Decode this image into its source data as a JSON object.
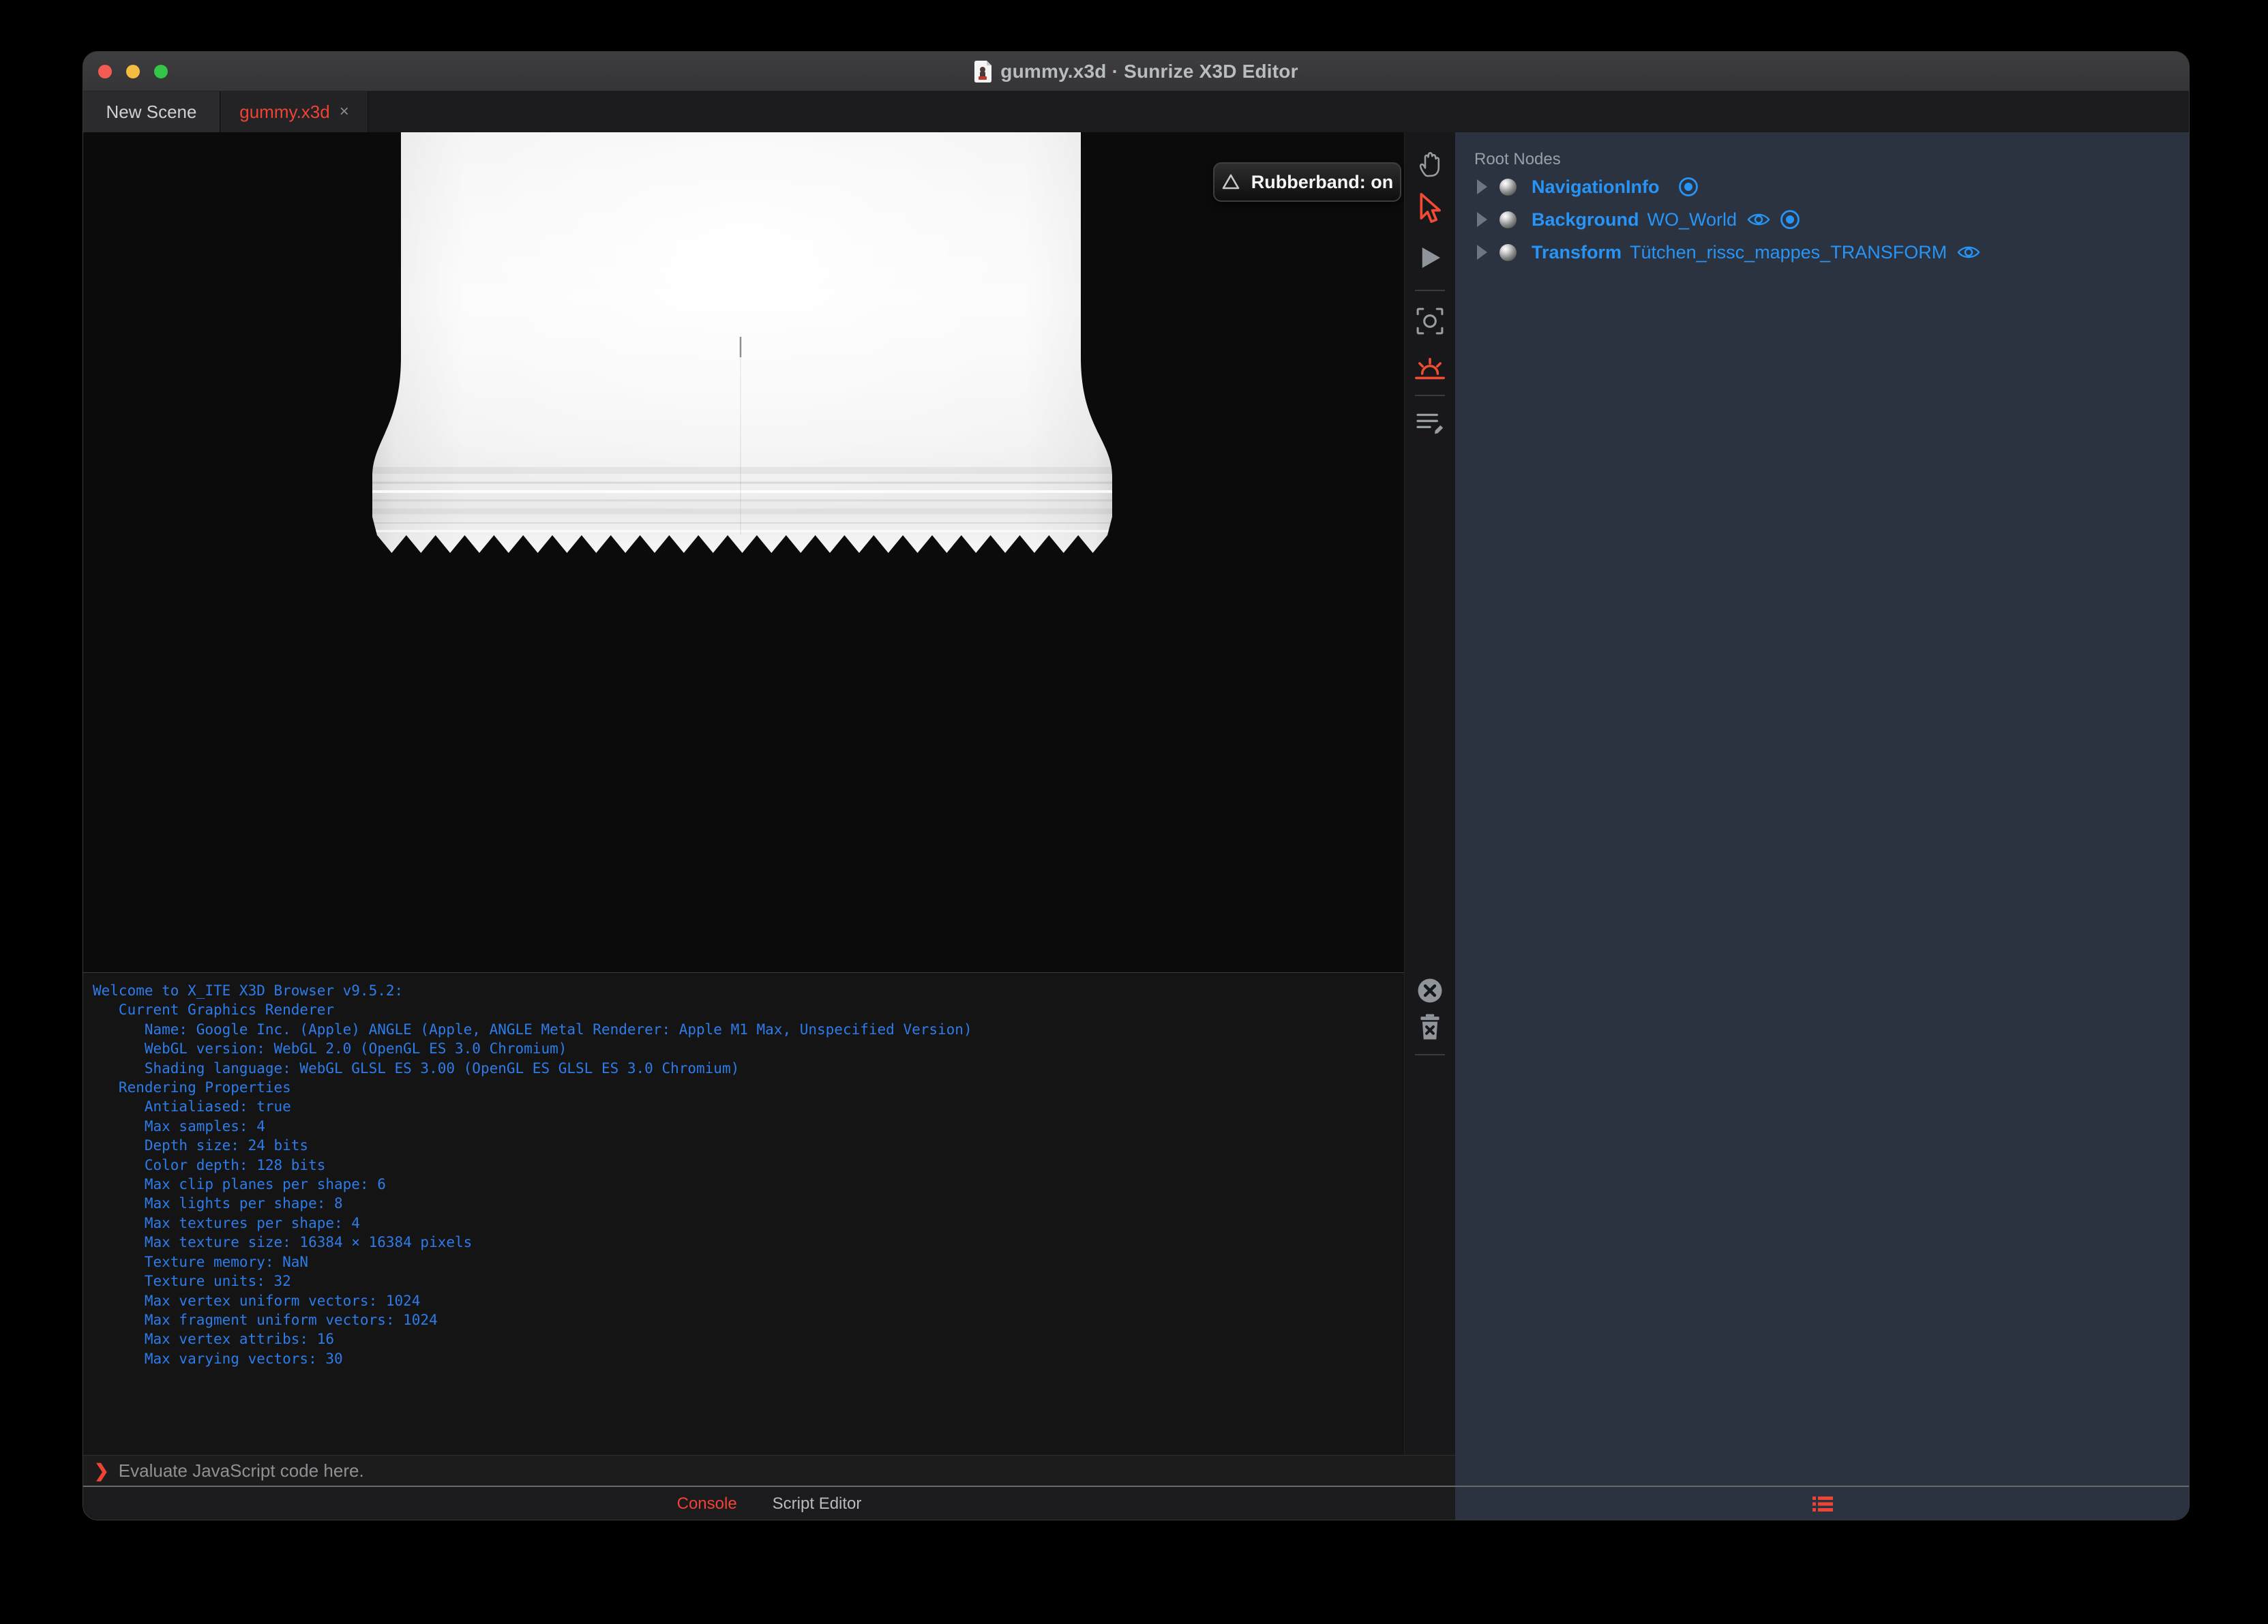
{
  "window": {
    "title": "gummy.x3d · Sunrize X3D Editor"
  },
  "tabs": [
    {
      "label": "New Scene",
      "active": false
    },
    {
      "label": "gummy.x3d",
      "close": "×",
      "active": true
    }
  ],
  "viewport": {
    "rubberband_label": "Rubberband: on"
  },
  "toolbar": {
    "tools": [
      "pan-hand",
      "select-arrow",
      "play",
      "center-view",
      "sunrise-light",
      "script-edit"
    ],
    "console_tools": [
      "clear-console",
      "trash"
    ]
  },
  "outline": {
    "header": "Root Nodes",
    "nodes": [
      {
        "type": "NavigationInfo",
        "name": "",
        "icons": [
          "bound"
        ]
      },
      {
        "type": "Background",
        "name": "WO_World",
        "icons": [
          "eye",
          "bound"
        ]
      },
      {
        "type": "Transform",
        "name": "Tütchen_rissc_mappes_TRANSFORM",
        "icons": [
          "eye"
        ]
      }
    ]
  },
  "console": {
    "lines": [
      "Welcome to X_ITE X3D Browser v9.5.2:",
      "   Current Graphics Renderer",
      "      Name: Google Inc. (Apple) ANGLE (Apple, ANGLE Metal Renderer: Apple M1 Max, Unspecified Version)",
      "      WebGL version: WebGL 2.0 (OpenGL ES 3.0 Chromium)",
      "      Shading language: WebGL GLSL ES 3.00 (OpenGL ES GLSL ES 3.0 Chromium)",
      "   Rendering Properties",
      "      Antialiased: true",
      "      Max samples: 4",
      "      Depth size: 24 bits",
      "      Color depth: 128 bits",
      "      Max clip planes per shape: 6",
      "      Max lights per shape: 8",
      "      Max textures per shape: 4",
      "      Max texture size: 16384 × 16384 pixels",
      "      Texture memory: NaN",
      "      Texture units: 32",
      "      Max vertex uniform vectors: 1024",
      "      Max fragment uniform vectors: 1024",
      "      Max vertex attribs: 16",
      "      Max varying vectors: 30"
    ],
    "prompt": "❯",
    "input_placeholder": "Evaluate JavaScript code here."
  },
  "bottom_tabs": [
    {
      "label": "Console",
      "active": true
    },
    {
      "label": "Script Editor",
      "active": false
    }
  ],
  "colors": {
    "accent_red": "#ef4334",
    "node_blue": "#2795f8",
    "console_blue": "#2d7cea",
    "panel_bg": "#2b3240",
    "traffic_red": "#f45b52",
    "traffic_yellow": "#f5bd3f",
    "traffic_green": "#34c648"
  }
}
